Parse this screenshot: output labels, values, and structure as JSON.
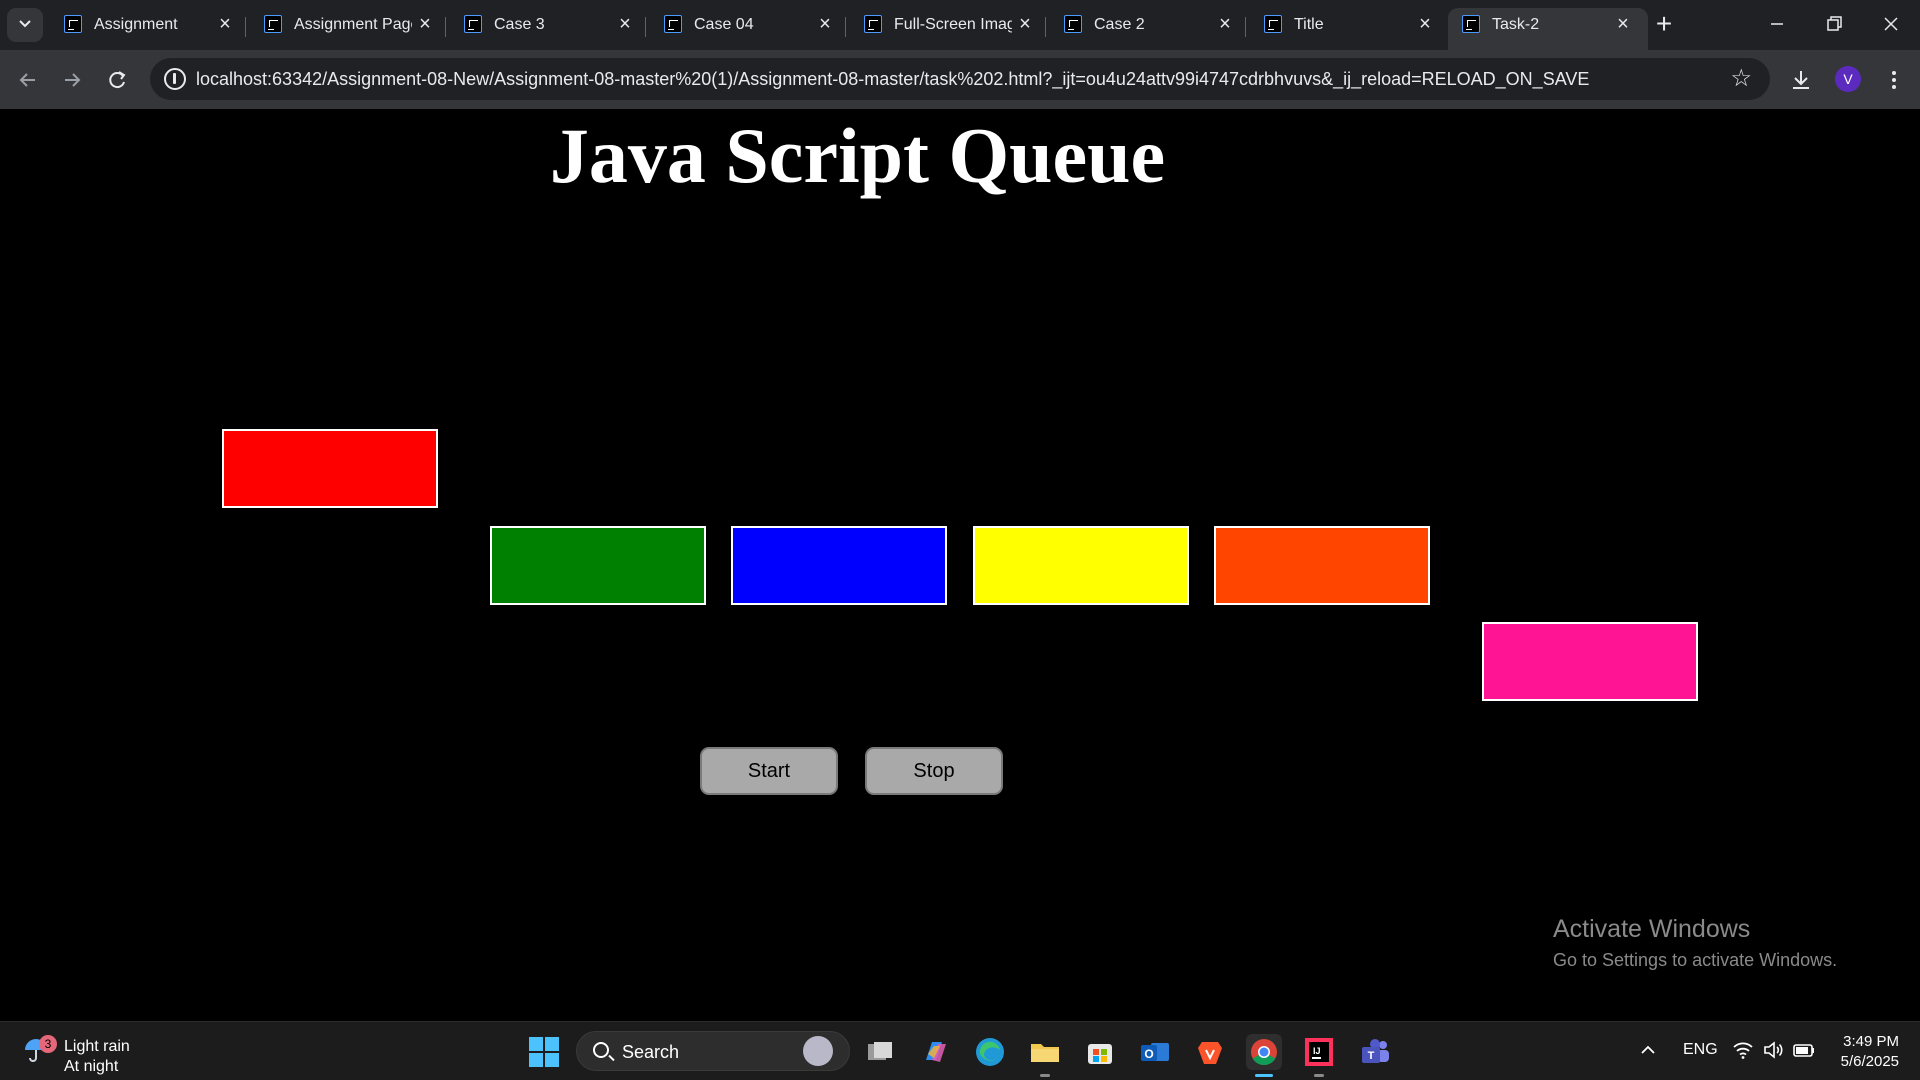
{
  "browser": {
    "tabs": [
      {
        "title": "Assignment",
        "active": false
      },
      {
        "title": "Assignment Page",
        "active": false
      },
      {
        "title": "Case 3",
        "active": false
      },
      {
        "title": "Case 04",
        "active": false
      },
      {
        "title": "Full-Screen Imag",
        "active": false
      },
      {
        "title": "Case 2",
        "active": false
      },
      {
        "title": "Title",
        "active": false
      },
      {
        "title": "Task-2",
        "active": true
      }
    ],
    "url": "localhost:63342/Assignment-08-New/Assignment-08-master%20(1)/Assignment-08-master/task%202.html?_ijt=ou4u24attv99i4747cdrbhvuvs&_ij_reload=RELOAD_ON_SAVE",
    "profile_initial": "V",
    "accent_color": "#5b2bbf"
  },
  "page": {
    "heading": "Java Script Queue",
    "boxes": [
      {
        "color": "#ff0000",
        "name": "red"
      },
      {
        "color": "#008000",
        "name": "green"
      },
      {
        "color": "#0000ff",
        "name": "blue"
      },
      {
        "color": "#ffff00",
        "name": "yellow"
      },
      {
        "color": "#ff4500",
        "name": "orange-red"
      },
      {
        "color": "#ff1493",
        "name": "deep-pink"
      }
    ],
    "start_label": "Start",
    "stop_label": "Stop"
  },
  "watermark": {
    "line1": "Activate Windows",
    "line2": "Go to Settings to activate Windows."
  },
  "taskbar": {
    "weather_badge": "3",
    "weather_line1": "Light rain",
    "weather_line2": "At night",
    "search_label": "Search",
    "language": "ENG",
    "time": "3:49 PM",
    "date": "5/6/2025"
  }
}
